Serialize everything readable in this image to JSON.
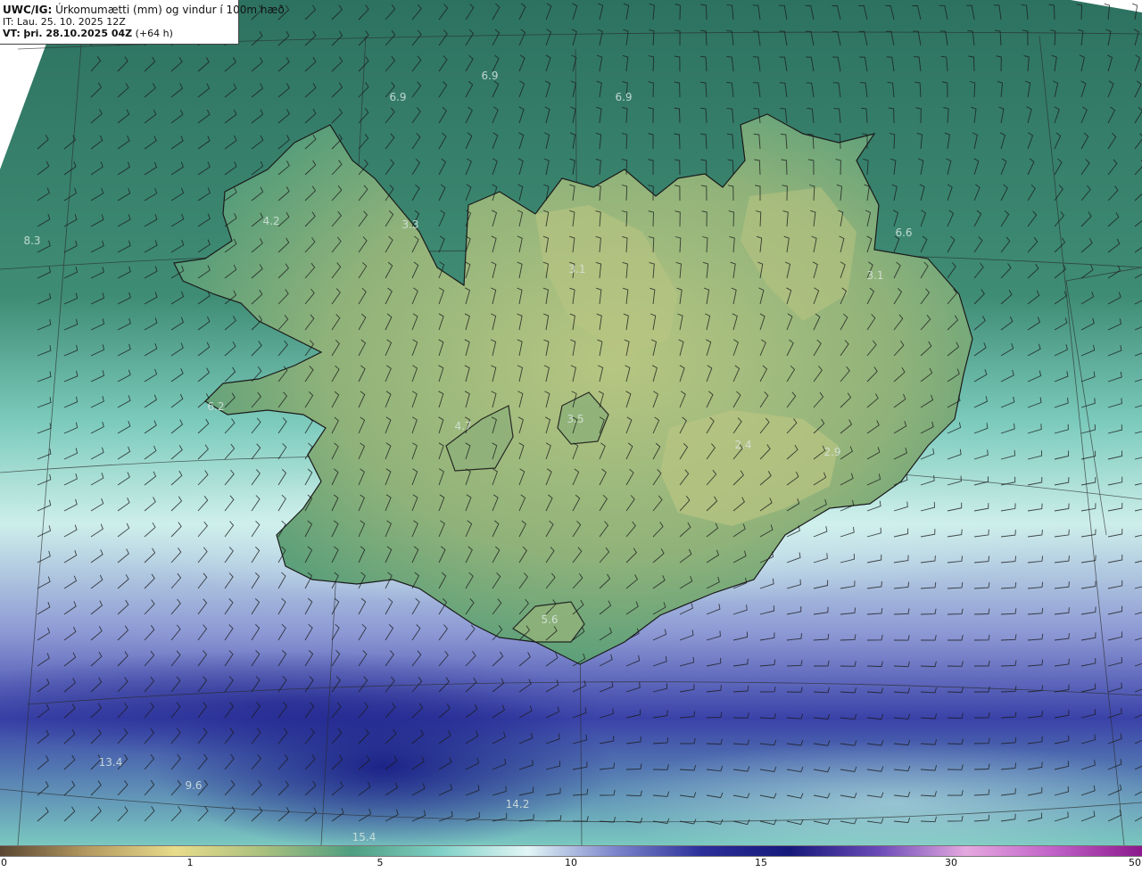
{
  "header": {
    "code": "UWC/IG:",
    "title": "Úrkomumætti (mm) og vindur í 100m hæð",
    "init_time": "IT: Lau. 25. 10. 2025 12Z",
    "valid_label": "VT:",
    "valid_time": "þri. 28.10.2025 04Z",
    "lead": "(+64 h)"
  },
  "map_values": [
    {
      "text": "6.9",
      "id": "v1"
    },
    {
      "text": "6.9",
      "id": "v2"
    },
    {
      "text": "6.9",
      "id": "v3"
    },
    {
      "text": "4.2",
      "id": "v4"
    },
    {
      "text": "3.3",
      "id": "v5"
    },
    {
      "text": "8.3",
      "id": "v6"
    },
    {
      "text": "3.1",
      "id": "v7"
    },
    {
      "text": "6.6",
      "id": "v8"
    },
    {
      "text": "3.1",
      "id": "v9"
    },
    {
      "text": "6.2",
      "id": "v10"
    },
    {
      "text": "4.7",
      "id": "v11"
    },
    {
      "text": "3.5",
      "id": "v12"
    },
    {
      "text": "2.4",
      "id": "v13"
    },
    {
      "text": "2.9",
      "id": "v14"
    },
    {
      "text": "5.6",
      "id": "v15"
    },
    {
      "text": "13.4",
      "id": "v16"
    },
    {
      "text": "9.6",
      "id": "v17"
    },
    {
      "text": "14.2",
      "id": "v18"
    },
    {
      "text": "15.4",
      "id": "v19"
    }
  ],
  "colorbar": {
    "ticks": [
      "0",
      "1",
      "5",
      "10",
      "15",
      "30",
      "50"
    ],
    "colors": [
      "#5a4632",
      "#b49a60",
      "#e8dc8a",
      "#a9c07e",
      "#4f9e80",
      "#7ed0c6",
      "#e2f6f6",
      "#7c86cc",
      "#2a2f9a",
      "#16197a",
      "#6a4ab8",
      "#e6a8e0",
      "#c060c8",
      "#8c1a8c"
    ]
  },
  "colors": {
    "sea_dark": "#2c7060",
    "sea_mid": "#4f9e84",
    "sea_light": "#bfeae4",
    "precip_heavy": "#232a96",
    "land": "#a6bf7a",
    "coast": "#1a1a1a",
    "wind_barb": "#1a1a1a"
  }
}
